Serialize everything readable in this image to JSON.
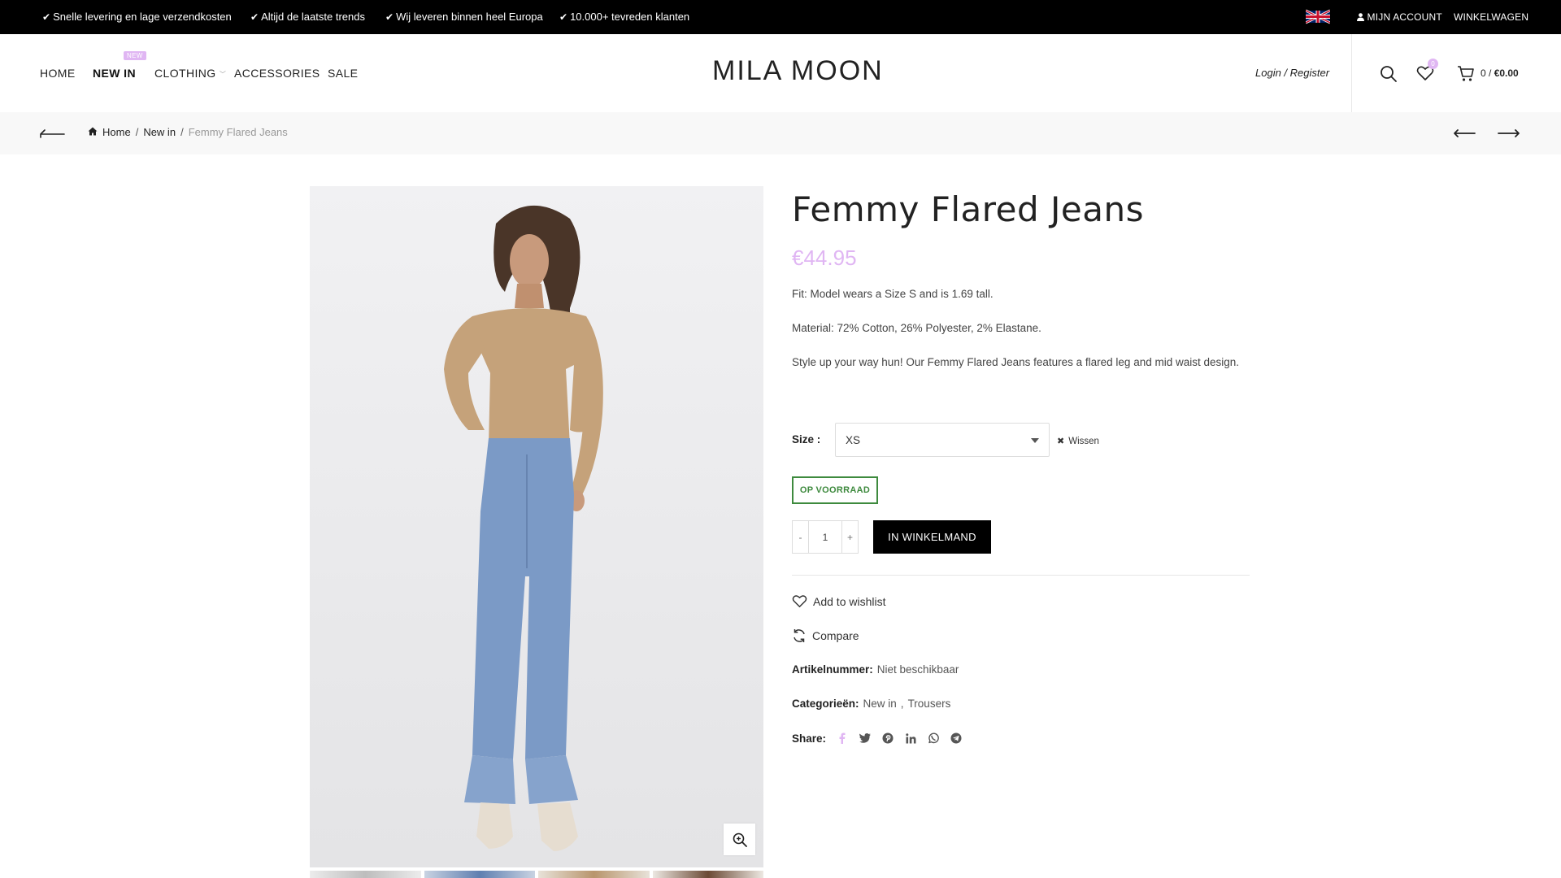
{
  "topbar": {
    "usps": [
      "Snelle levering en lage verzendkosten",
      "Altijd de laatste trends",
      "Wij leveren binnen heel Europa",
      "10.000+ tevreden klanten"
    ],
    "account_label": "MIJN ACCOUNT",
    "cart_label": "WINKELWAGEN",
    "language_icon": "uk-flag-icon"
  },
  "header": {
    "nav": [
      "HOME",
      "NEW IN",
      "CLOTHING",
      "ACCESSORIES",
      "SALE"
    ],
    "new_badge": "NEW",
    "logo": "MILA MOON",
    "login_register": "Login / Register",
    "wishlist_count": "0",
    "cart_count": "0",
    "cart_sep": " / ",
    "cart_total": "€0.00"
  },
  "breadcrumb": {
    "home": "Home",
    "parent": "New in",
    "current": "Femmy Flared Jeans",
    "sep": "/"
  },
  "product": {
    "title": "Femmy Flared Jeans",
    "price": "€44.95",
    "fit": "Fit: Model wears a Size S and is 1.69 tall.",
    "material": "Material: 72% Cotton, 26% Polyester, 2% Elastane.",
    "description": "Style up your way hun! Our Femmy Flared Jeans features a flared leg and mid waist design.",
    "size_label": "Size :",
    "size_value": "XS",
    "clear_label": "Wissen",
    "stock_label": "OP VOORRAAD",
    "qty_minus": "-",
    "qty_value": "1",
    "qty_plus": "+",
    "add_to_cart": "IN WINKELMAND",
    "wishlist_label": "Add to wishlist",
    "compare_label": "Compare",
    "sku_label": "Artikelnummer:",
    "sku_value": "Niet beschikbaar",
    "categories_label": "Categorieën:",
    "categories": [
      "New in",
      "Trousers"
    ],
    "categories_sep": ",",
    "share_label": "Share:",
    "share_icons": [
      "facebook-icon",
      "twitter-icon",
      "pinterest-icon",
      "linkedin-icon",
      "whatsapp-icon",
      "telegram-icon"
    ]
  },
  "colors": {
    "accent": "#e0b6f3",
    "stock_green": "#3e8a3e",
    "topbar_bg": "#000000",
    "crumb_bg": "#f8f8f8"
  }
}
